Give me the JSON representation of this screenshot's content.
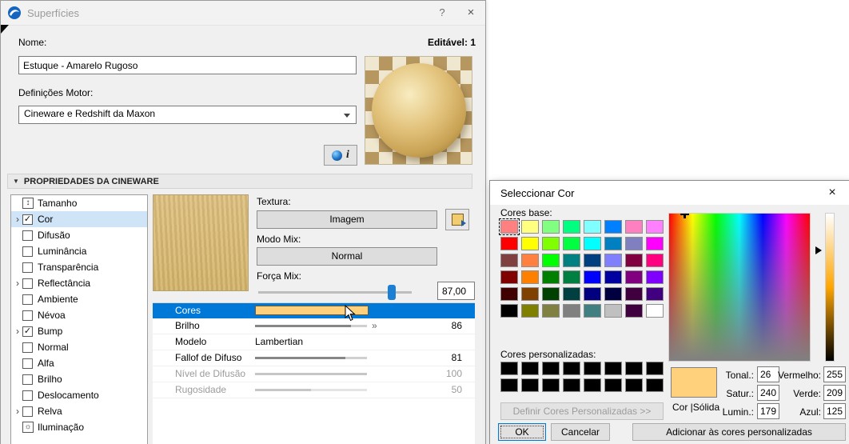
{
  "surfaces": {
    "title": "Superfícies",
    "help_label": "?",
    "close_label": "×",
    "name_label": "Nome:",
    "editable_label": "Editável: 1",
    "name_value": "Estuque - Amarelo Rugoso",
    "engine_label": "Definições Motor:",
    "engine_value": "Cineware e Redshift da Maxon",
    "info_label": "i",
    "section_label": "PROPRIEDADES DA CINEWARE",
    "texture_label": "Textura:",
    "texture_button": "Imagem",
    "mix_mode_label": "Modo Mix:",
    "mix_mode_button": "Normal",
    "mix_strength_label": "Força Mix:",
    "mix_strength_value": "87,00",
    "mix_strength_percent": 87,
    "channels": [
      {
        "label": "Tamanho",
        "icon": "size"
      },
      {
        "label": "Cor",
        "checked": true,
        "expandable": true,
        "selected": true
      },
      {
        "label": "Difusão",
        "checked": false
      },
      {
        "label": "Luminância",
        "checked": false
      },
      {
        "label": "Transparência",
        "checked": false
      },
      {
        "label": "Reflectância",
        "checked": false,
        "expandable": true
      },
      {
        "label": "Ambiente",
        "checked": false
      },
      {
        "label": "Névoa",
        "checked": false
      },
      {
        "label": "Bump",
        "checked": true,
        "expandable": true
      },
      {
        "label": "Normal",
        "checked": false
      },
      {
        "label": "Alfa",
        "checked": false
      },
      {
        "label": "Brilho",
        "checked": false
      },
      {
        "label": "Deslocamento",
        "checked": false
      },
      {
        "label": "Relva",
        "checked": false,
        "expandable": true
      },
      {
        "label": "Iluminação",
        "icon": "light"
      }
    ],
    "properties": [
      {
        "label": "Cores",
        "kind": "color",
        "selected": true
      },
      {
        "label": "Brilho",
        "kind": "slider",
        "value": "86",
        "percent": 86,
        "marker": "»"
      },
      {
        "label": "Modelo",
        "kind": "text",
        "text": "Lambertian"
      },
      {
        "label": "Fallof de Difuso",
        "kind": "slider",
        "value": "81",
        "percent": 81
      },
      {
        "label": "Nível de Difusão",
        "kind": "slider",
        "value": "100",
        "percent": 100,
        "disabled": true
      },
      {
        "label": "Rugosidade",
        "kind": "slider",
        "value": "50",
        "percent": 50,
        "disabled": true
      }
    ]
  },
  "color_picker": {
    "title": "Seleccionar Cor",
    "close_label": "×",
    "basic_label": "Cores base:",
    "custom_label": "Cores personalizadas:",
    "define_button": "Definir Cores Personalizadas >>",
    "color_solid_label": "Cor |Sólida",
    "hue_label": "Tonal.:",
    "hue_value": "26",
    "sat_label": "Satur.:",
    "sat_value": "240",
    "lum_label": "Lumin.:",
    "lum_value": "179",
    "red_label": "Vermelho:",
    "red_value": "255",
    "green_label": "Verde:",
    "green_value": "209",
    "blue_label": "Azul:",
    "blue_value": "125",
    "ok_button": "OK",
    "cancel_button": "Cancelar",
    "add_button": "Adicionar às cores personalizadas",
    "basic_colors": [
      "#FF8080",
      "#FFFF80",
      "#80FF80",
      "#00FF80",
      "#80FFFF",
      "#0080FF",
      "#FF80C0",
      "#FF80FF",
      "#FF0000",
      "#FFFF00",
      "#80FF00",
      "#00FF40",
      "#00FFFF",
      "#0080C0",
      "#8080C0",
      "#FF00FF",
      "#804040",
      "#FF8040",
      "#00FF00",
      "#008080",
      "#004080",
      "#8080FF",
      "#800040",
      "#FF0080",
      "#800000",
      "#FF8000",
      "#008000",
      "#008040",
      "#0000FF",
      "#0000A0",
      "#800080",
      "#8000FF",
      "#400000",
      "#804000",
      "#004000",
      "#004040",
      "#000080",
      "#000040",
      "#400040",
      "#400080",
      "#000000",
      "#808000",
      "#808040",
      "#808080",
      "#408080",
      "#C0C0C0",
      "#400040",
      "#FFFFFF"
    ],
    "custom_colors": [
      "#000000",
      "#000000",
      "#000000",
      "#000000",
      "#000000",
      "#000000",
      "#000000",
      "#000000",
      "#000000",
      "#000000",
      "#000000",
      "#000000",
      "#000000",
      "#000000",
      "#000000",
      "#000000"
    ]
  },
  "icons": {
    "collapse": "▼",
    "chevron": "›",
    "check": "✓",
    "size": "↕",
    "light": "☼"
  },
  "colors": {
    "accent": "#0078d7",
    "selected_color": "#FFD17D",
    "row_highlight": "#cfe4f7"
  }
}
